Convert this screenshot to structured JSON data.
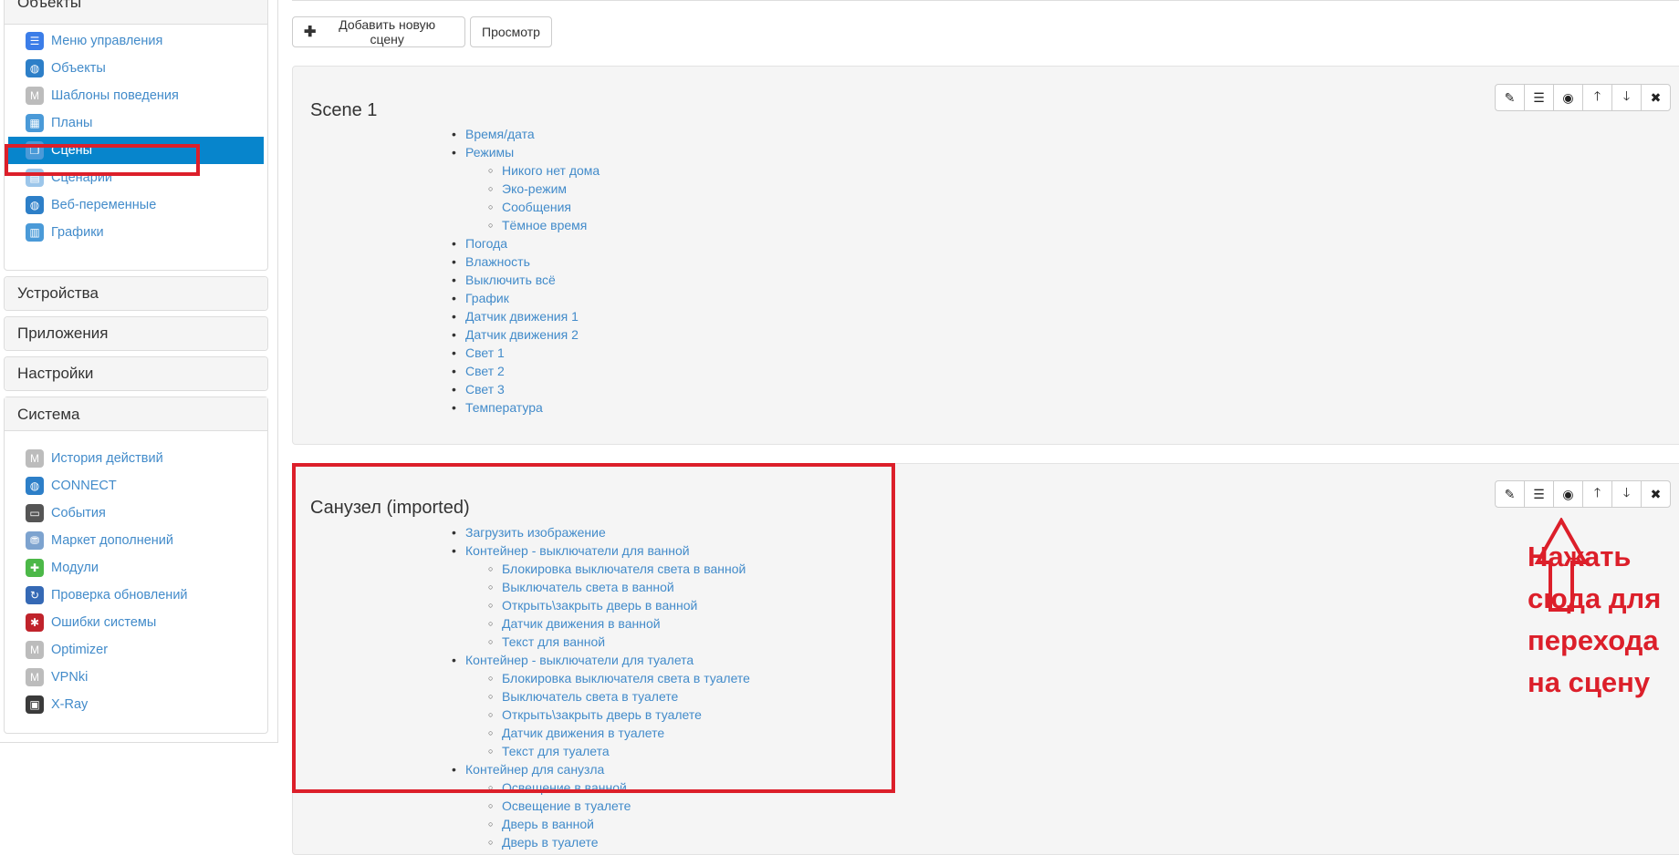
{
  "sidebar": {
    "objects_panel": {
      "title": "Объекты",
      "items": [
        {
          "label": "Меню управления",
          "icon": "menu-icon",
          "color": "#3b7de8"
        },
        {
          "label": "Объекты",
          "icon": "globe-icon",
          "color": "#2d7fc8"
        },
        {
          "label": "Шаблоны поведения",
          "icon": "module-icon",
          "color": "#bcbcbc"
        },
        {
          "label": "Планы",
          "icon": "plan-icon",
          "color": "#4a9ad8"
        },
        {
          "label": "Сцены",
          "icon": "scenes-icon",
          "color": "#4a9ad8"
        },
        {
          "label": "Сценарии",
          "icon": "scripts-icon",
          "color": "#9cc6ea"
        },
        {
          "label": "Веб-переменные",
          "icon": "web-globe-icon",
          "color": "#2d7fc8"
        },
        {
          "label": "Графики",
          "icon": "chart-icon",
          "color": "#4a9ad8"
        }
      ]
    },
    "devices_panel": {
      "title": "Устройства"
    },
    "apps_panel": {
      "title": "Приложения"
    },
    "settings_panel": {
      "title": "Настройки"
    },
    "system_panel": {
      "title": "Система",
      "items": [
        {
          "label": "История действий",
          "icon": "module-icon",
          "color": "#bcbcbc"
        },
        {
          "label": "CONNECT",
          "icon": "globe-icon",
          "color": "#2d7fc8"
        },
        {
          "label": "События",
          "icon": "laptop-icon",
          "color": "#555555"
        },
        {
          "label": "Маркет дополнений",
          "icon": "market-icon",
          "color": "#7da3cf"
        },
        {
          "label": "Модули",
          "icon": "puzzle-icon",
          "color": "#4cb848"
        },
        {
          "label": "Проверка обновлений",
          "icon": "update-icon",
          "color": "#3569b5"
        },
        {
          "label": "Ошибки системы",
          "icon": "bug-icon",
          "color": "#c0232b"
        },
        {
          "label": "Optimizer",
          "icon": "module-icon",
          "color": "#bcbcbc"
        },
        {
          "label": "VPNki",
          "icon": "module-icon",
          "color": "#bcbcbc"
        },
        {
          "label": "X-Ray",
          "icon": "monitor-icon",
          "color": "#3a3a3a"
        }
      ]
    }
  },
  "main": {
    "add_scene_label": "Добавить новую сцену",
    "preview_label": "Просмотр",
    "scenes": [
      {
        "title": "Scene 1",
        "tree": [
          {
            "label": "Время/дата",
            "level": 1
          },
          {
            "label": "Режимы",
            "level": 1
          },
          {
            "label": "Никого нет дома",
            "level": 2
          },
          {
            "label": "Эко-режим",
            "level": 2
          },
          {
            "label": "Сообщения",
            "level": 2
          },
          {
            "label": "Тёмное время",
            "level": 2
          },
          {
            "label": "Погода",
            "level": 1
          },
          {
            "label": "Влажность",
            "level": 1
          },
          {
            "label": "Выключить всё",
            "level": 1
          },
          {
            "label": "График",
            "level": 1
          },
          {
            "label": "Датчик движения 1",
            "level": 1
          },
          {
            "label": "Датчик движения 2",
            "level": 1
          },
          {
            "label": "Свет 1",
            "level": 1
          },
          {
            "label": "Свет 2",
            "level": 1
          },
          {
            "label": "Свет 3",
            "level": 1
          },
          {
            "label": "Температура",
            "level": 1
          }
        ]
      },
      {
        "title": "Санузел (imported)",
        "tree": [
          {
            "label": "Загрузить изображение",
            "level": 1
          },
          {
            "label": "Контейнер - выключатели для ванной",
            "level": 1
          },
          {
            "label": "Блокировка выключателя света в ванной",
            "level": 2
          },
          {
            "label": "Выключатель света в ванной",
            "level": 2
          },
          {
            "label": "Открыть\\закрыть дверь в ванной",
            "level": 2
          },
          {
            "label": "Датчик движения в ванной",
            "level": 2
          },
          {
            "label": "Текст для ванной",
            "level": 2
          },
          {
            "label": "Контейнер - выключатели для туалета",
            "level": 1
          },
          {
            "label": "Блокировка выключателя света в туалете",
            "level": 2
          },
          {
            "label": "Выключатель света в туалете",
            "level": 2
          },
          {
            "label": "Открыть\\закрыть дверь в туалете",
            "level": 2
          },
          {
            "label": "Датчик движения в туалете",
            "level": 2
          },
          {
            "label": "Текст для туалета",
            "level": 2
          },
          {
            "label": "Контейнер для санузла",
            "level": 1
          },
          {
            "label": "Освещение в ванной",
            "level": 2
          },
          {
            "label": "Освещение в туалете",
            "level": 2
          },
          {
            "label": "Дверь в ванной",
            "level": 2
          },
          {
            "label": "Дверь в туалете",
            "level": 2
          }
        ]
      }
    ],
    "toolbar_buttons": [
      {
        "name": "edit-button",
        "icon": "pencil-icon",
        "glyph": "✎"
      },
      {
        "name": "list-button",
        "icon": "list-icon",
        "glyph": "☰"
      },
      {
        "name": "view-button",
        "icon": "eye-icon",
        "glyph": "◉"
      },
      {
        "name": "move-up-button",
        "icon": "arrow-up-icon",
        "glyph": "🡑"
      },
      {
        "name": "move-down-button",
        "icon": "arrow-down-icon",
        "glyph": "🡓"
      },
      {
        "name": "delete-button",
        "icon": "close-icon",
        "glyph": "✖"
      }
    ]
  },
  "annotation": {
    "line1": "Нажать сюда для",
    "line2": "перехода на сцену",
    "color": "#dc1f2a"
  }
}
